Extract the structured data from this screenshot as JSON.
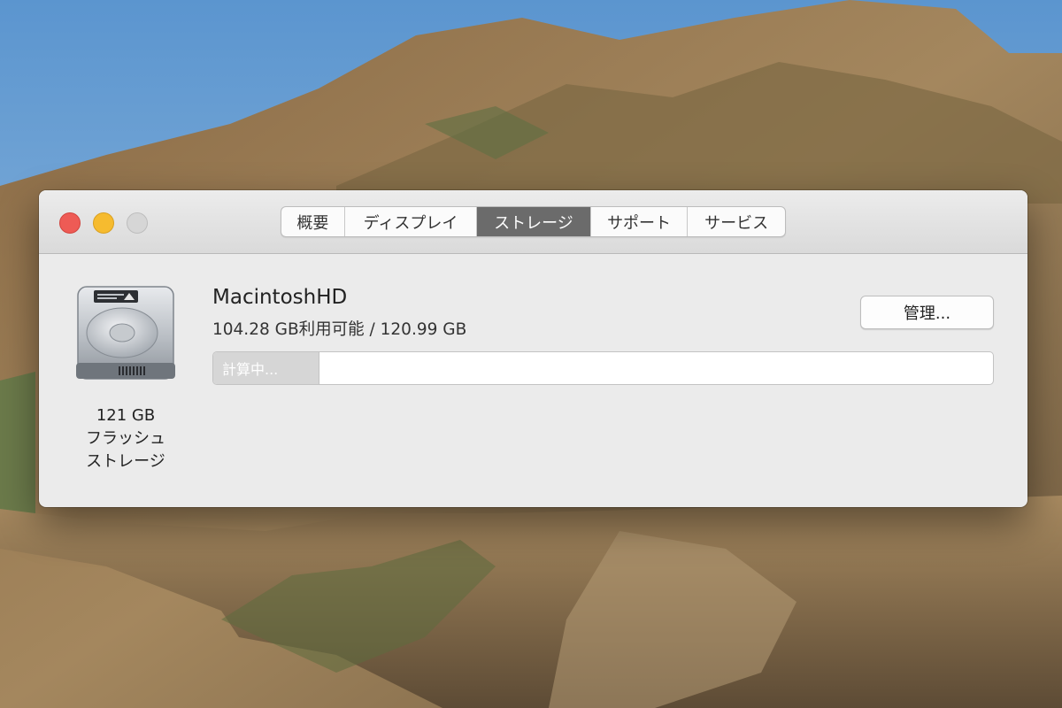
{
  "window": {
    "tabs": [
      {
        "label": "概要"
      },
      {
        "label": "ディスプレイ"
      },
      {
        "label": "ストレージ"
      },
      {
        "label": "サポート"
      },
      {
        "label": "サービス"
      }
    ],
    "selected_tab": "ストレージ"
  },
  "drive": {
    "icon": "hard-drive-icon",
    "capacity": "121 GB",
    "type_line1": "フラッシュ",
    "type_line2": "ストレージ"
  },
  "volume": {
    "name": "MacintoshHD",
    "availability": "104.28 GB利用可能 / 120.99 GB",
    "bar_status": "計算中...",
    "manage_label": "管理..."
  },
  "colors": {
    "close": "#ee5b55",
    "minimize": "#f6bb2f",
    "selected_tab": "#6b6b6b"
  }
}
